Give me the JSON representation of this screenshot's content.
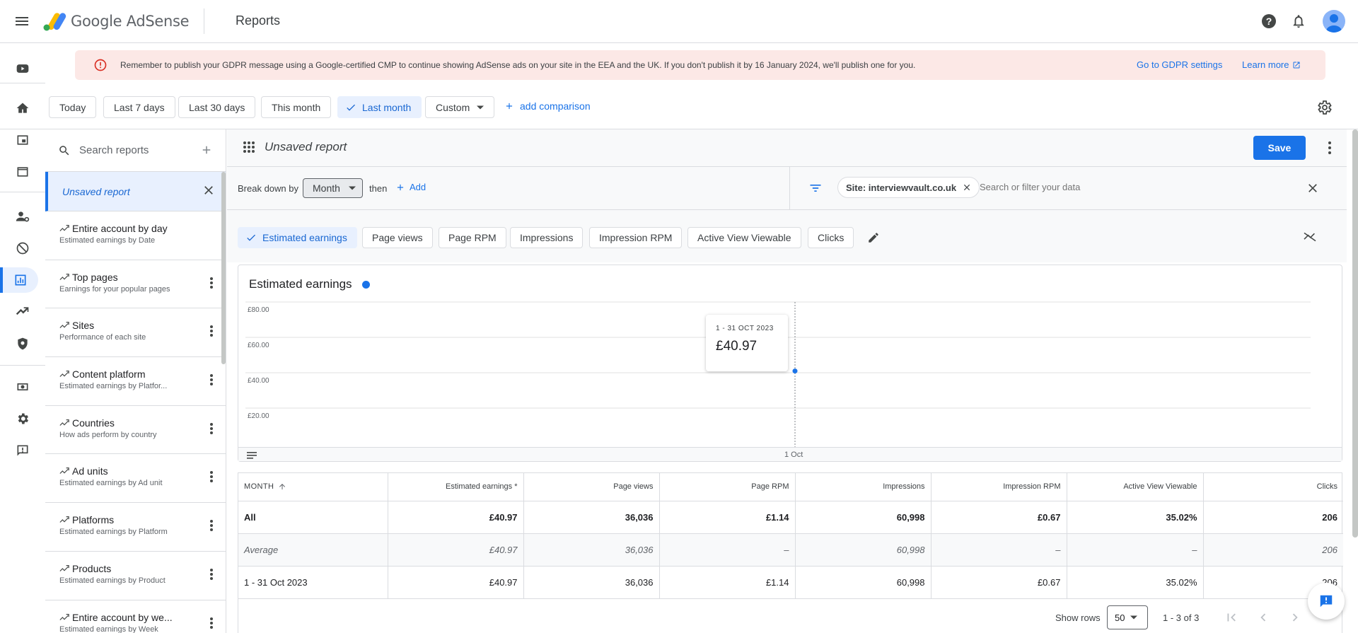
{
  "app": {
    "brand": "Google AdSense",
    "page_title": "Reports"
  },
  "colors": {
    "accent": "#1a73e8",
    "banner_bg": "#fce8e6",
    "error": "#d93025",
    "series": "#1a73e8"
  },
  "topbar_icons": [
    "menu-icon",
    "help-icon",
    "notifications-icon",
    "account-avatar"
  ],
  "banner": {
    "message": "Remember to publish your GDPR message using a Google-certified CMP to continue showing AdSense ads on your site in the EEA and the UK. If you don't publish it by 16 January 2024, we'll publish one for you.",
    "gdpr_link": "Go to GDPR settings",
    "learn_more": "Learn more"
  },
  "date_ranges": [
    "Today",
    "Last 7 days",
    "Last 30 days",
    "This month",
    "Last month",
    "Custom"
  ],
  "selected_range": "Last month",
  "add_comparison": "add comparison",
  "sidebar": {
    "search_placeholder": "Search reports",
    "unsaved": "Unsaved report",
    "items": [
      {
        "title": "Entire account by day",
        "subtitle": "Estimated earnings by Date"
      },
      {
        "title": "Top pages",
        "subtitle": "Earnings for your popular pages"
      },
      {
        "title": "Sites",
        "subtitle": "Performance of each site"
      },
      {
        "title": "Content platform",
        "subtitle": "Estimated earnings by Platfor..."
      },
      {
        "title": "Countries",
        "subtitle": "How ads perform by country"
      },
      {
        "title": "Ad units",
        "subtitle": "Estimated earnings by Ad unit"
      },
      {
        "title": "Platforms",
        "subtitle": "Estimated earnings by Platform"
      },
      {
        "title": "Products",
        "subtitle": "Estimated earnings by Product"
      },
      {
        "title": "Entire account by we...",
        "subtitle": "Estimated earnings by Week"
      }
    ]
  },
  "report": {
    "title": "Unsaved report",
    "save": "Save",
    "breakdown_label": "Break down by",
    "breakdown_value": "Month",
    "then": "then",
    "add": "Add",
    "filter_chip": "Site: interviewvault.co.uk",
    "filter_placeholder": "Search or filter your data"
  },
  "metrics": [
    "Estimated earnings",
    "Page views",
    "Page RPM",
    "Impressions",
    "Impression RPM",
    "Active View Viewable",
    "Clicks"
  ],
  "selected_metric": "Estimated earnings",
  "chart_data": {
    "type": "line",
    "title": "Estimated earnings",
    "x": [
      "1 Oct"
    ],
    "series": [
      {
        "values": [
          40.97
        ]
      }
    ],
    "yticks": [
      "£80.00",
      "£60.00",
      "£40.00",
      "£20.00"
    ],
    "ylim": [
      0,
      80
    ],
    "grid": true,
    "tooltip": {
      "date": "1 - 31 OCT 2023",
      "value": "£40.97"
    }
  },
  "table": {
    "headers": [
      "MONTH",
      "Estimated earnings *",
      "Page views",
      "Page RPM",
      "Impressions",
      "Impression RPM",
      "Active View Viewable",
      "Clicks"
    ],
    "rows": [
      [
        "All",
        "£40.97",
        "36,036",
        "£1.14",
        "60,998",
        "£0.67",
        "35.02%",
        "206"
      ],
      [
        "Average",
        "£40.97",
        "36,036",
        "–",
        "60,998",
        "–",
        "–",
        "206"
      ],
      [
        "1 - 31 Oct 2023",
        "£40.97",
        "36,036",
        "£1.14",
        "60,998",
        "£0.67",
        "35.02%",
        "206"
      ]
    ]
  },
  "pagination": {
    "show_rows_label": "Show rows",
    "rows_value": "50",
    "range": "1 - 3 of 3"
  }
}
